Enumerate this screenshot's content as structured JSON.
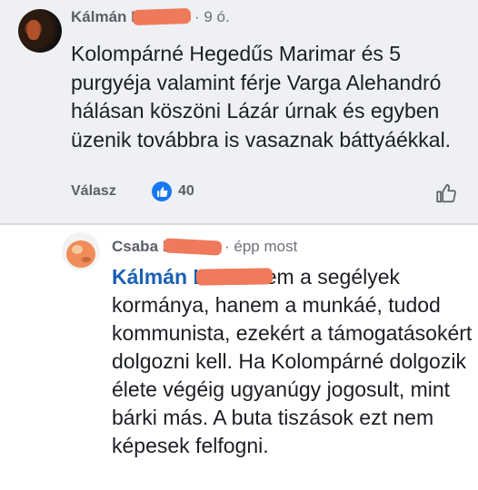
{
  "comment": {
    "author": "Kálmán La",
    "time": "· 9 ó.",
    "text": "Kolompárné Hegedűs Marimar és 5 purgyéja valamint férje Varga Alehandró hálásan köszöni Lázár úrnak és egyben üzenik továbbra is vasaznak báttyáékkal.",
    "reply_label": "Válasz",
    "reaction_count": "40"
  },
  "reply": {
    "author": "Csaba K",
    "time": "· épp most",
    "mention": "Kálmán La",
    "text": " Ez nem a segélyek kormánya, hanem a munkáé, tudod kommunista, ezekért a támogatásokért dolgozni kell. Ha Kolompárné dolgozik élete végéig ugyanúgy jogosult, mint bárki más. A buta tiszások ezt nem képesek felfogni."
  },
  "colors": {
    "top_background": "#eef0f3",
    "text": "#1b1e23",
    "muted": "#5a5f67",
    "mention": "#1a5fb4",
    "like_blue": "#1877f2",
    "redaction": "#ef7a5b"
  },
  "icons": {
    "like_badge": "thumbs-up-icon",
    "like_action": "thumbs-up-outline-icon"
  }
}
